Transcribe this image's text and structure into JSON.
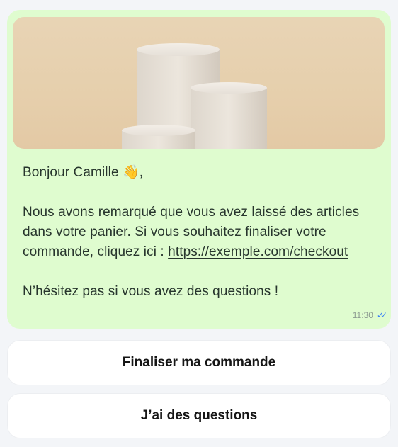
{
  "message": {
    "greeting": "Bonjour Camille 👋,",
    "body_line1": "Nous avons remarqué que vous avez laissé des articles dans votre panier. Si vous souhaitez finaliser votre commande, cliquez ici : ",
    "link": "https://exemple.com/checkout",
    "closing": "N’hésitez pas si vous avez des questions !",
    "time": "11:30",
    "status_icon": "double-check-icon"
  },
  "buttons": {
    "primary": "Finaliser ma commande",
    "secondary": "J’ai des questions"
  },
  "colors": {
    "bubble": "#dffccf",
    "button_bg": "#ffffff",
    "read_tick": "#3b82f6"
  }
}
